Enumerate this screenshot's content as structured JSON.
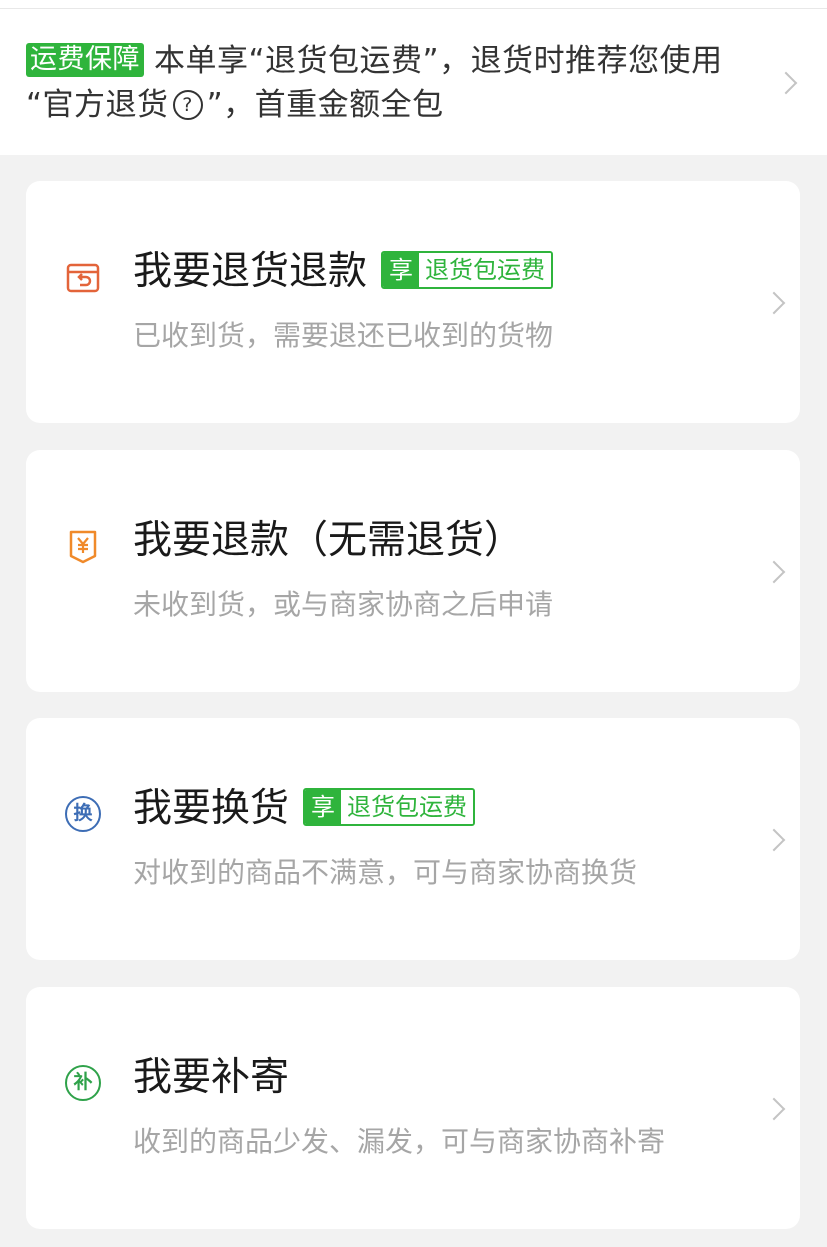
{
  "banner": {
    "badge": "运费保障",
    "line1": "本单享“退货包运费”，退货时推荐您使用",
    "line2_pre": "“官方退货",
    "help_icon_glyph": "?",
    "line2_post": "”，首重金额全包"
  },
  "cards": [
    {
      "icon": "return-box-icon",
      "icon_color": "#e3643a",
      "title": "我要退货退款",
      "tag": {
        "left": "享",
        "right": "退货包运费"
      },
      "desc": "已收到货，需要退还已收到的货物"
    },
    {
      "icon": "refund-yuan-icon",
      "icon_color": "#f08a2a",
      "title": "我要退款（无需退货）",
      "desc": "未收到货，或与商家协商之后申请"
    },
    {
      "icon": "exchange-icon",
      "icon_glyph": "换",
      "icon_color": "#3d6db5",
      "title": "我要换货",
      "tag": {
        "left": "享",
        "right": "退货包运费"
      },
      "desc": "对收到的商品不满意，可与商家协商换货"
    },
    {
      "icon": "reship-icon",
      "icon_glyph": "补",
      "icon_color": "#2fa24a",
      "title": "我要补寄",
      "desc": "收到的商品少发、漏发，可与商家协商补寄"
    }
  ],
  "colors": {
    "accent_green": "#2fb43c",
    "background": "#f2f2f2",
    "desc_gray": "#a6a6a6"
  }
}
